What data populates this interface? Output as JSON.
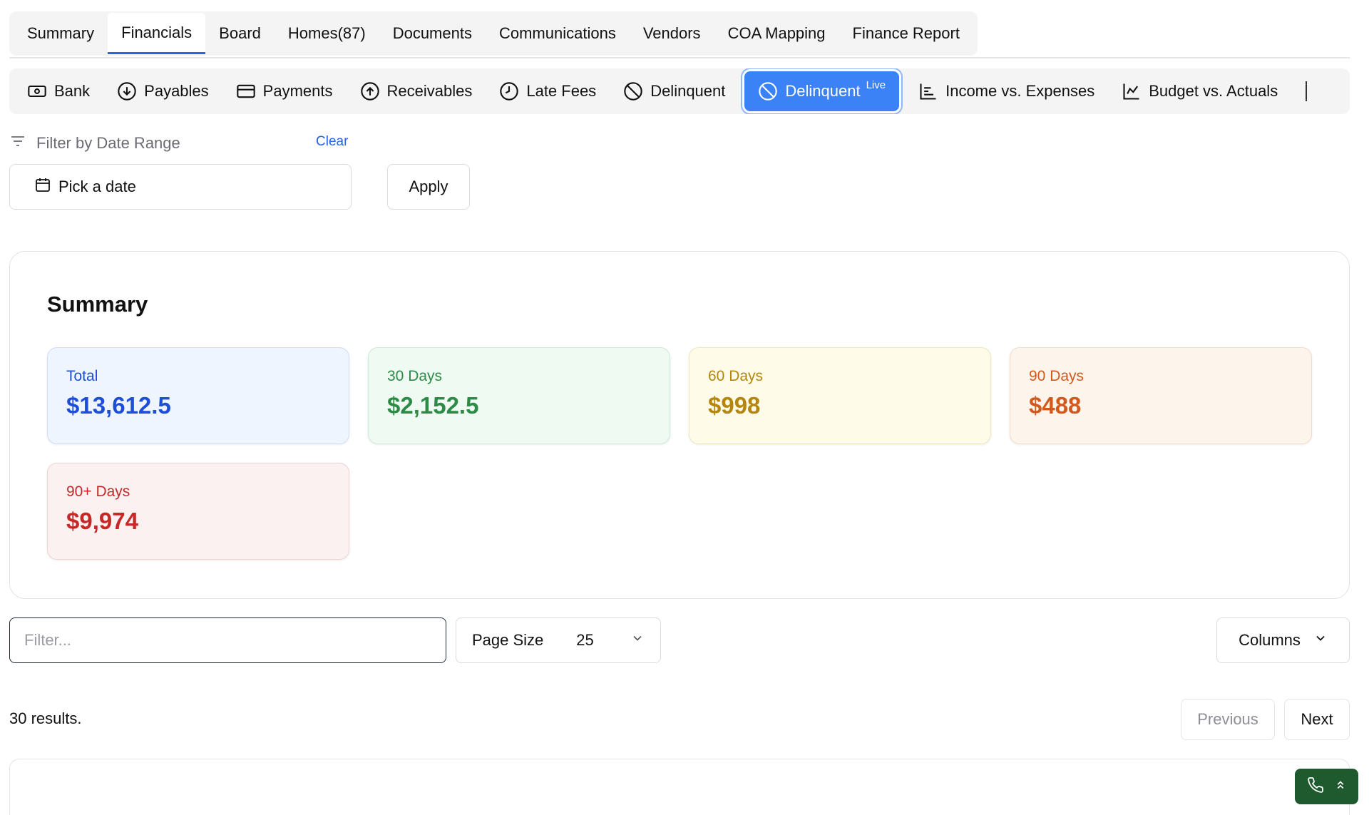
{
  "top_tabs": [
    {
      "label": "Summary"
    },
    {
      "label": "Financials"
    },
    {
      "label": "Board"
    },
    {
      "label": "Homes(87)"
    },
    {
      "label": "Documents"
    },
    {
      "label": "Communications"
    },
    {
      "label": "Vendors"
    },
    {
      "label": "COA Mapping"
    },
    {
      "label": "Finance Report"
    }
  ],
  "active_top_tab": "Financials",
  "sub_tabs": [
    {
      "label": "Bank",
      "icon": "cash-icon"
    },
    {
      "label": "Payables",
      "icon": "arrow-down-circle-icon"
    },
    {
      "label": "Payments",
      "icon": "credit-card-icon"
    },
    {
      "label": "Receivables",
      "icon": "arrow-up-circle-icon"
    },
    {
      "label": "Late Fees",
      "icon": "clock-icon"
    },
    {
      "label": "Delinquent",
      "icon": "ban-icon"
    },
    {
      "label": "Delinquent",
      "badge": "Live",
      "icon": "ban-icon"
    },
    {
      "label": "Income vs. Expenses",
      "icon": "bar-chart-icon"
    },
    {
      "label": "Budget vs. Actuals",
      "icon": "line-chart-icon"
    }
  ],
  "active_sub_tab": "Delinquent Live",
  "filter": {
    "label": "Filter by Date Range",
    "clear": "Clear",
    "date_placeholder": "Pick a date",
    "apply": "Apply"
  },
  "summary": {
    "title": "Summary",
    "cards": {
      "total": {
        "label": "Total",
        "value": "$13,612.5"
      },
      "d30": {
        "label": "30 Days",
        "value": "$2,152.5"
      },
      "d60": {
        "label": "60 Days",
        "value": "$998"
      },
      "d90": {
        "label": "90 Days",
        "value": "$488"
      },
      "d90p": {
        "label": "90+ Days",
        "value": "$9,974"
      }
    }
  },
  "table": {
    "filter_placeholder": "Filter...",
    "page_size_label": "Page Size",
    "page_size_value": "25",
    "columns_label": "Columns",
    "results": "30 results.",
    "previous": "Previous",
    "next": "Next"
  },
  "colors": {
    "accent": "#3b82f6",
    "total": "#1d4ed8",
    "d30": "#2e8b47",
    "d60": "#b5860f",
    "d90": "#d2591d",
    "d90p": "#c62828",
    "widget": "#1f5a2e"
  }
}
